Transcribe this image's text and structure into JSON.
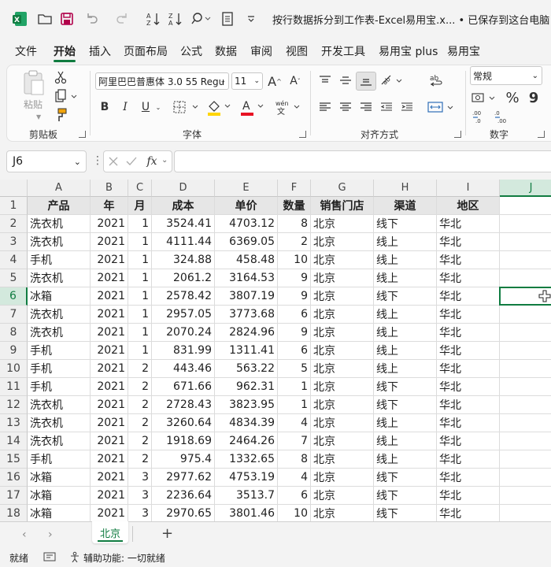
{
  "title": "按行数据拆分到工作表-Excel易用宝.x... • 已保存到这台电脑 ⌄",
  "menu": [
    "文件",
    "开始",
    "插入",
    "页面布局",
    "公式",
    "数据",
    "审阅",
    "视图",
    "开发工具",
    "易用宝 plus",
    "易用宝"
  ],
  "ribbon": {
    "paste_label": "粘贴",
    "font_name": "阿里巴巴普惠体 3.0 55 Regu",
    "font_size": "11",
    "bold": "B",
    "italic": "I",
    "underline": "U",
    "number_format": "常规",
    "groups": {
      "clipboard": "剪贴板",
      "font": "字体",
      "align": "对齐方式",
      "number": "数字"
    },
    "increase_font": "A",
    "decrease_font": "A",
    "percent": "%",
    "phonetic_top": "wén",
    "phonetic_bottom": "文",
    "wrap": "ab",
    "comma": "9",
    "dec_inc": ".00",
    "dec_dec": ".0"
  },
  "colors": {
    "accent": "#107c41",
    "tab_green": "#0f7b3f",
    "fill_yellow": "#ffd500",
    "font_red": "#e81123"
  },
  "formula_bar": {
    "cell_ref": "J6",
    "fx": "fx",
    "formula": ""
  },
  "grid": {
    "columns": [
      "A",
      "B",
      "C",
      "D",
      "E",
      "F",
      "G",
      "H",
      "I",
      "J"
    ],
    "selected_cell": "J6",
    "rows": [
      [
        "1",
        "产品",
        "年",
        "月",
        "成本",
        "单价",
        "数量",
        "销售门店",
        "渠道",
        "地区"
      ],
      [
        "2",
        "洗衣机",
        "2021",
        "1",
        "3524.41",
        "4703.12",
        "8",
        "北京",
        "线下",
        "华北"
      ],
      [
        "3",
        "洗衣机",
        "2021",
        "1",
        "4111.44",
        "6369.05",
        "2",
        "北京",
        "线上",
        "华北"
      ],
      [
        "4",
        "手机",
        "2021",
        "1",
        "324.88",
        "458.48",
        "10",
        "北京",
        "线上",
        "华北"
      ],
      [
        "5",
        "洗衣机",
        "2021",
        "1",
        "2061.2",
        "3164.53",
        "9",
        "北京",
        "线上",
        "华北"
      ],
      [
        "6",
        "冰箱",
        "2021",
        "1",
        "2578.42",
        "3807.19",
        "9",
        "北京",
        "线下",
        "华北"
      ],
      [
        "7",
        "洗衣机",
        "2021",
        "1",
        "2957.05",
        "3773.68",
        "6",
        "北京",
        "线上",
        "华北"
      ],
      [
        "8",
        "洗衣机",
        "2021",
        "1",
        "2070.24",
        "2824.96",
        "9",
        "北京",
        "线上",
        "华北"
      ],
      [
        "9",
        "手机",
        "2021",
        "1",
        "831.99",
        "1311.41",
        "6",
        "北京",
        "线上",
        "华北"
      ],
      [
        "10",
        "手机",
        "2021",
        "2",
        "443.46",
        "563.22",
        "5",
        "北京",
        "线上",
        "华北"
      ],
      [
        "11",
        "手机",
        "2021",
        "2",
        "671.66",
        "962.31",
        "1",
        "北京",
        "线下",
        "华北"
      ],
      [
        "12",
        "洗衣机",
        "2021",
        "2",
        "2728.43",
        "3823.95",
        "1",
        "北京",
        "线下",
        "华北"
      ],
      [
        "13",
        "洗衣机",
        "2021",
        "2",
        "3260.64",
        "4834.39",
        "4",
        "北京",
        "线上",
        "华北"
      ],
      [
        "14",
        "洗衣机",
        "2021",
        "2",
        "1918.69",
        "2464.26",
        "7",
        "北京",
        "线上",
        "华北"
      ],
      [
        "15",
        "手机",
        "2021",
        "2",
        "975.4",
        "1332.65",
        "8",
        "北京",
        "线上",
        "华北"
      ],
      [
        "16",
        "冰箱",
        "2021",
        "3",
        "2977.62",
        "4753.19",
        "4",
        "北京",
        "线下",
        "华北"
      ],
      [
        "17",
        "冰箱",
        "2021",
        "3",
        "2236.64",
        "3513.7",
        "6",
        "北京",
        "线下",
        "华北"
      ],
      [
        "18",
        "冰箱",
        "2021",
        "3",
        "2970.65",
        "3801.46",
        "10",
        "北京",
        "线下",
        "华北"
      ]
    ]
  },
  "sheet_tabs": {
    "active": "北京",
    "add": "+"
  },
  "status": {
    "ready": "就绪",
    "accessibility": "辅助功能: 一切就绪"
  }
}
